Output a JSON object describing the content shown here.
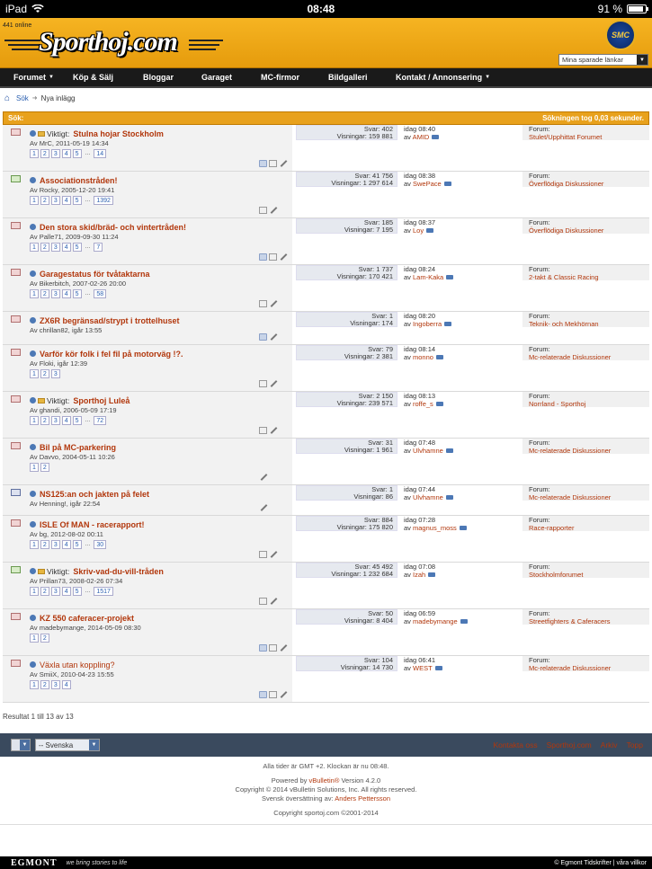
{
  "status": {
    "device": "iPad",
    "time": "08:48",
    "battery": "91 %"
  },
  "header": {
    "online": "441 online",
    "logo": "Sporthoj.com",
    "badge": "SMC",
    "bookmarks": "Mina sparade länkar"
  },
  "nav": [
    {
      "label": "Forumet",
      "caret": true
    },
    {
      "label": "Köp & Sälj",
      "caret": false
    },
    {
      "label": "Bloggar",
      "caret": false
    },
    {
      "label": "Garaget",
      "caret": false
    },
    {
      "label": "MC-firmor",
      "caret": false
    },
    {
      "label": "Bildgalleri",
      "caret": false
    },
    {
      "label": "Kontakt / Annonsering",
      "caret": true
    }
  ],
  "breadcrumb": {
    "search": "Sök",
    "current": "Nya inlägg"
  },
  "search": {
    "label": "Sök:",
    "timing": "Sökningen tog 0,03 sekunder."
  },
  "threads": [
    {
      "important": true,
      "prefix": "Viktigt:",
      "title": "Stulna hojar Stockholm",
      "by": "Av MrC, 2011-05-19 14:34",
      "pages": [
        "1",
        "2",
        "3",
        "4",
        "5",
        "...",
        "14"
      ],
      "replies": "Svar: 402",
      "views": "Visningar: 159 881",
      "last_time": "idag 08:40",
      "last_by": "AMID",
      "forum_label": "Forum:",
      "forum": "Stulet/Upphittat Forumet",
      "bold": true,
      "icon": "red"
    },
    {
      "important": false,
      "prefix": "",
      "title": "Associationstråden!",
      "by": "Av Rocky, 2005-12-20 19:41",
      "pages": [
        "1",
        "2",
        "3",
        "4",
        "5",
        "...",
        "1392"
      ],
      "replies": "Svar: 41 756",
      "views": "Visningar: 1 297 614",
      "last_time": "idag 08:38",
      "last_by": "SwePace",
      "forum_label": "Forum:",
      "forum": "Överflödiga Diskussioner",
      "bold": true,
      "icon": "green"
    },
    {
      "important": false,
      "prefix": "",
      "title": "Den stora skid/bräd- och vintertråden!",
      "by": "Av Palle71, 2009-09-30 11:24",
      "pages": [
        "1",
        "2",
        "3",
        "4",
        "5",
        "...",
        "7"
      ],
      "replies": "Svar: 185",
      "views": "Visningar: 7 195",
      "last_time": "idag 08:37",
      "last_by": "Loy",
      "forum_label": "Forum:",
      "forum": "Överflödiga Diskussioner",
      "bold": true,
      "icon": "red"
    },
    {
      "important": false,
      "prefix": "",
      "title": "Garagestatus för tvåtaktarna",
      "by": "Av Bikerbitch, 2007-02-26 20:00",
      "pages": [
        "1",
        "2",
        "3",
        "4",
        "5",
        "...",
        "58"
      ],
      "replies": "Svar: 1 737",
      "views": "Visningar: 170 421",
      "last_time": "idag 08:24",
      "last_by": "Lam-Kaka",
      "forum_label": "Forum:",
      "forum": "2-takt & Classic Racing",
      "bold": true,
      "icon": "red"
    },
    {
      "important": false,
      "prefix": "",
      "title": "ZX6R begränsad/strypt i trottelhuset",
      "by": "Av chrillan82, igår 13:55",
      "pages": [],
      "replies": "Svar: 1",
      "views": "Visningar: 174",
      "last_time": "idag 08:20",
      "last_by": "Ingoberra",
      "forum_label": "Forum:",
      "forum": "Teknik- och Mekhörnan",
      "bold": true,
      "icon": "red"
    },
    {
      "important": false,
      "prefix": "",
      "title": "Varför kör folk i fel fil på motorväg !?.",
      "by": "Av Floki, igår 12:39",
      "pages": [
        "1",
        "2",
        "3"
      ],
      "replies": "Svar: 79",
      "views": "Visningar: 2 381",
      "last_time": "idag 08:14",
      "last_by": "monno",
      "forum_label": "Forum:",
      "forum": "Mc-relaterade Diskussioner",
      "bold": true,
      "icon": "red"
    },
    {
      "important": true,
      "prefix": "Viktigt:",
      "title": "Sporthoj Luleå",
      "by": "Av ghandi, 2006-05-09 17:19",
      "pages": [
        "1",
        "2",
        "3",
        "4",
        "5",
        "...",
        "72"
      ],
      "replies": "Svar: 2 150",
      "views": "Visningar: 239 571",
      "last_time": "idag 08:13",
      "last_by": "roffe_s",
      "forum_label": "Forum:",
      "forum": "Norrland - Sporthoj",
      "bold": true,
      "icon": "red"
    },
    {
      "important": false,
      "prefix": "",
      "title": "Bil på MC-parkering",
      "by": "Av Davvo, 2004-05-11 10:26",
      "pages": [
        "1",
        "2"
      ],
      "replies": "Svar: 31",
      "views": "Visningar: 1 961",
      "last_time": "idag 07:48",
      "last_by": "Ulvhamne",
      "forum_label": "Forum:",
      "forum": "Mc-relaterade Diskussioner",
      "bold": true,
      "icon": "red"
    },
    {
      "important": false,
      "prefix": "",
      "title": "NS125:an och jakten på felet",
      "by": "Av Henning!, igår 22:54",
      "pages": [],
      "replies": "Svar: 1",
      "views": "Visningar: 86",
      "last_time": "idag 07:44",
      "last_by": "Ulvhamne",
      "forum_label": "Forum:",
      "forum": "Mc-relaterade Diskussioner",
      "bold": true,
      "icon": "blue"
    },
    {
      "important": false,
      "prefix": "",
      "title": "ISLE Of MAN - racerapport!",
      "by": "Av bg, 2012-08-02 00:11",
      "pages": [
        "1",
        "2",
        "3",
        "4",
        "5",
        "...",
        "30"
      ],
      "replies": "Svar: 884",
      "views": "Visningar: 175 820",
      "last_time": "idag 07:28",
      "last_by": "magnus_moss",
      "forum_label": "Forum:",
      "forum": "Race-rapporter",
      "bold": true,
      "icon": "red"
    },
    {
      "important": true,
      "prefix": "Viktigt:",
      "title": "Skriv-vad-du-vill-tråden",
      "by": "Av Prillan73, 2008-02-26 07:34",
      "pages": [
        "1",
        "2",
        "3",
        "4",
        "5",
        "...",
        "1517"
      ],
      "replies": "Svar: 45 492",
      "views": "Visningar: 1 232 684",
      "last_time": "idag 07:08",
      "last_by": "Izah",
      "forum_label": "Forum:",
      "forum": "Stockholmforumet",
      "bold": true,
      "icon": "green"
    },
    {
      "important": false,
      "prefix": "",
      "title": "KZ 550 caferacer-projekt",
      "by": "Av madebymange, 2014-05-09 08:30",
      "pages": [
        "1",
        "2"
      ],
      "replies": "Svar: 50",
      "views": "Visningar: 8 404",
      "last_time": "idag 06:59",
      "last_by": "madebymange",
      "forum_label": "Forum:",
      "forum": "Streetfighters & Caferacers",
      "bold": true,
      "icon": "red"
    },
    {
      "important": false,
      "prefix": "",
      "title": "Växla utan koppling?",
      "by": "Av SmiiX, 2010-04-23 15:55",
      "pages": [
        "1",
        "2",
        "3",
        "4"
      ],
      "replies": "Svar: 104",
      "views": "Visningar: 14 730",
      "last_time": "idag 06:41",
      "last_by": "WEST",
      "forum_label": "Forum:",
      "forum": "Mc-relaterade Diskussioner",
      "bold": false,
      "icon": "red"
    }
  ],
  "result_count": "Resultat 1 till 13 av 13",
  "footer": {
    "language": "-- Svenska",
    "links": [
      "Kontakta oss",
      "Sporthoj.com",
      "Arkiv",
      "Topp"
    ],
    "timezone": "Alla tider är GMT +2. Klockan är nu 08:48.",
    "powered": "Powered by",
    "vb": "vBulletin®",
    "version": "Version 4.2.0",
    "copyright_vb": "Copyright © 2014 vBulletin Solutions, Inc. All rights reserved.",
    "translation": "Svensk översättning av:",
    "translator": "Anders Pettersson",
    "copyright_site": "Copyright sportoj.com ©2001-2014"
  },
  "egmont": {
    "brand": "EGMONT",
    "slogan": "we bring stories to life",
    "right": "© Egmont Tidskrifter | våra villkor"
  }
}
